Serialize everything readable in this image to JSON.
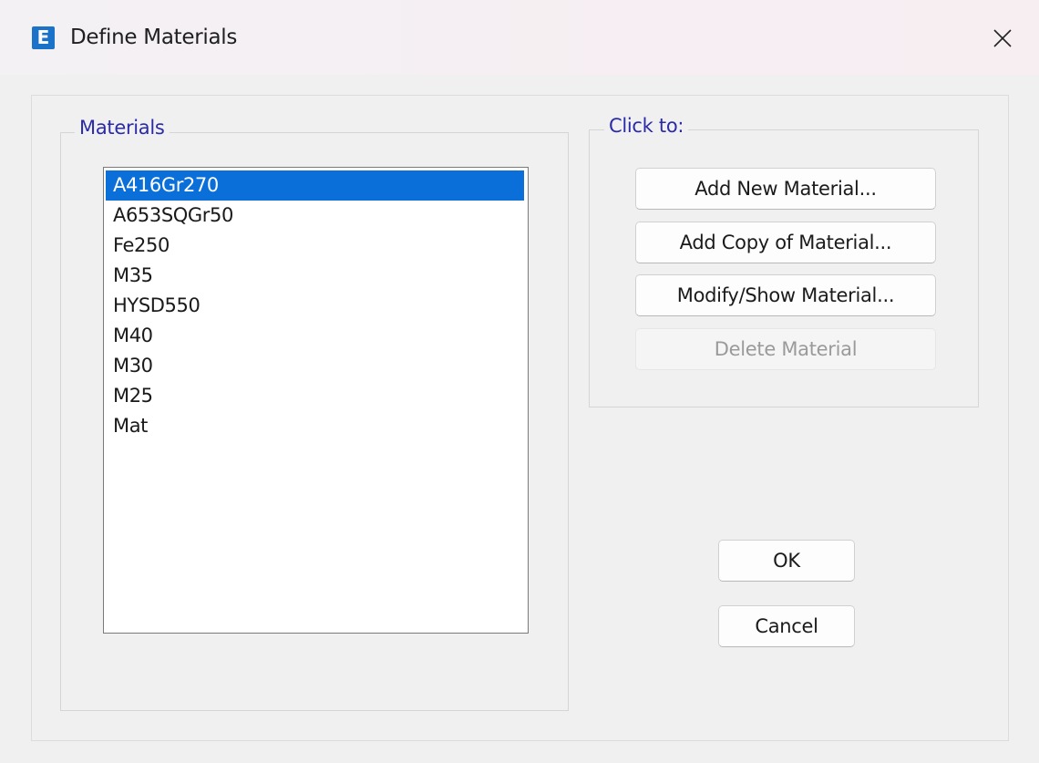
{
  "window": {
    "title": "Define Materials",
    "app_icon_letter": "E",
    "app_icon_color": "#1a73c8"
  },
  "materials_group": {
    "label": "Materials",
    "items": [
      {
        "name": "A416Gr270",
        "selected": true
      },
      {
        "name": "A653SQGr50",
        "selected": false
      },
      {
        "name": "Fe250",
        "selected": false
      },
      {
        "name": "M35",
        "selected": false
      },
      {
        "name": "HYSD550",
        "selected": false
      },
      {
        "name": "M40",
        "selected": false
      },
      {
        "name": "M30",
        "selected": false
      },
      {
        "name": "M25",
        "selected": false
      },
      {
        "name": "Mat",
        "selected": false
      }
    ],
    "selection_color": "#0a6fd8"
  },
  "click_to_group": {
    "label": "Click to:",
    "add_new_label": "Add New Material...",
    "add_copy_label": "Add Copy of Material...",
    "modify_show_label": "Modify/Show Material...",
    "delete_label": "Delete Material",
    "delete_enabled": false
  },
  "footer": {
    "ok_label": "OK",
    "cancel_label": "Cancel"
  },
  "colors": {
    "group_label": "#2b2ba8",
    "dialog_bg": "#f0f0f0"
  }
}
